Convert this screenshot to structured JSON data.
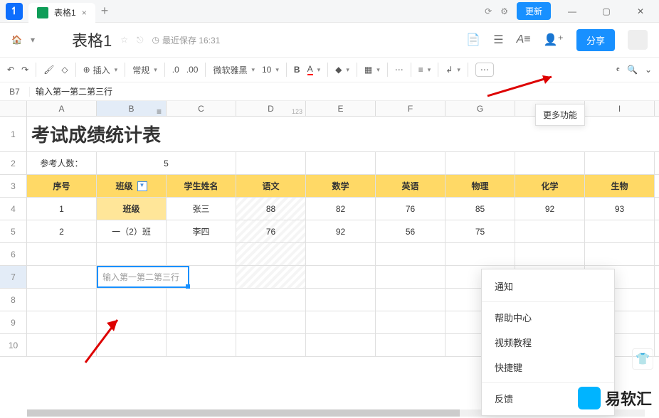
{
  "titlebar": {
    "tab_title": "表格1",
    "close": "×",
    "add": "+",
    "update": "更新"
  },
  "header": {
    "doc_title": "表格1",
    "save_info": "最近保存 16:31",
    "share": "分享"
  },
  "toolbar": {
    "insert": "插入",
    "format": "常规",
    "decimal": ".0",
    "decimal2": ".00",
    "font": "微软雅黑",
    "size": "10",
    "bold": "B",
    "font_color": "A",
    "more_tooltip": "更多功能"
  },
  "formula": {
    "ref": "B7",
    "content": "输入第一第二第三行"
  },
  "cols": [
    "A",
    "B",
    "C",
    "D",
    "E",
    "F",
    "G",
    "H",
    "I"
  ],
  "col_hint_d": "123",
  "sheet": {
    "title": "考试成绩统计表",
    "ref_label": "参考人数：",
    "ref_value": "5",
    "headers": [
      "序号",
      "班级",
      "学生姓名",
      "语文",
      "数学",
      "英语",
      "物理",
      "化学",
      "生物"
    ],
    "rows": [
      {
        "seq": "1",
        "class": "班级",
        "name": "张三",
        "yw": "88",
        "sx": "82",
        "yy": "76",
        "wl": "85",
        "hx": "92",
        "sw": "93"
      },
      {
        "seq": "2",
        "class": "一（2）班",
        "name": "李四",
        "yw": "76",
        "sx": "92",
        "yy": "56",
        "wl": "75",
        "hx": "",
        "sw": ""
      }
    ],
    "editing": "输入第一第二第三行"
  },
  "menu": {
    "notify": "通知",
    "help": "帮助中心",
    "video": "视频教程",
    "shortcut": "快捷键",
    "feedback": "反馈"
  },
  "logo": "易软汇"
}
